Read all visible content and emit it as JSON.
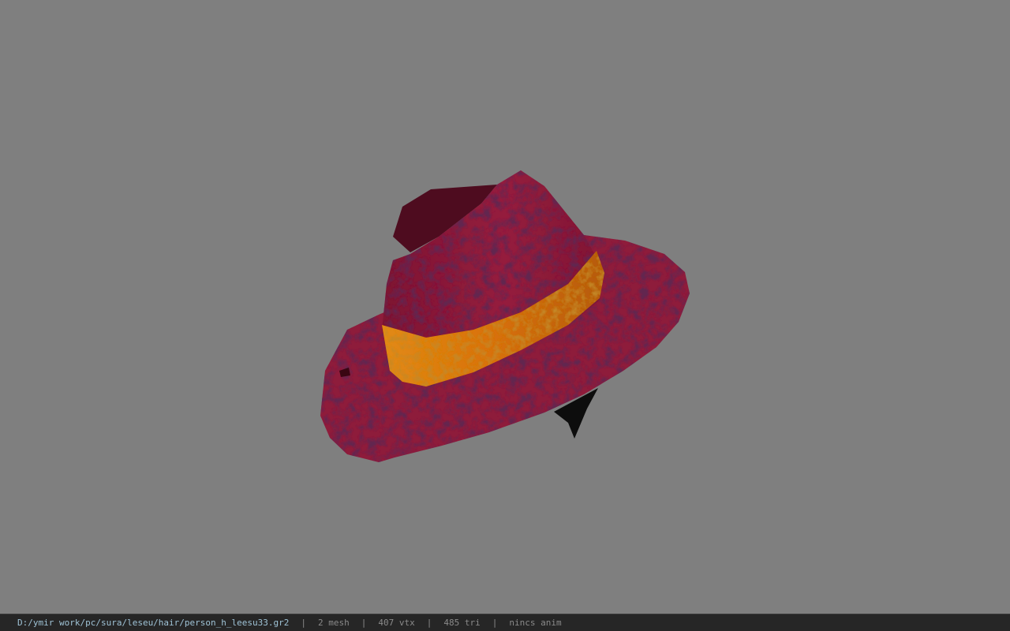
{
  "viewport": {
    "background_color": "#7f7f7f",
    "model": {
      "object": "hat-model",
      "crown_color": "#8c1a38",
      "brim_color": "#8e1b3a",
      "band_color": "#d8700c",
      "shadow_color": "#0d0d0d"
    }
  },
  "status_bar": {
    "file_path": "D:/ymir work/pc/sura/leseu/hair/person_h_leesu33.gr2",
    "separator": "|",
    "mesh_count": "2 mesh",
    "vertex_count": "407 vtx",
    "triangle_count": "485 tri",
    "anim_status": "nincs anim",
    "path_color": "#9fc3d6",
    "text_color": "#8a8a8a"
  }
}
